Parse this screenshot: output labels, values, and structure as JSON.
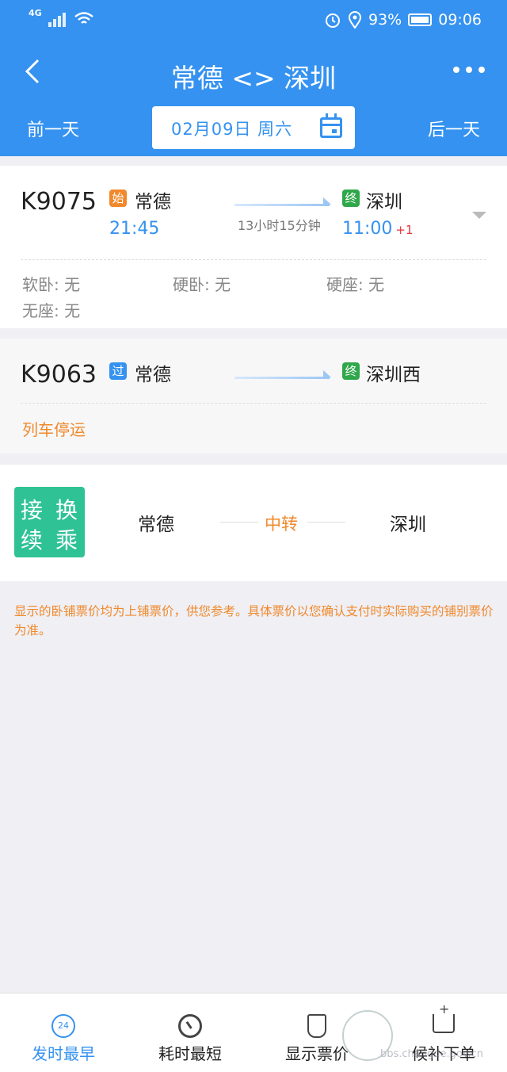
{
  "status": {
    "network": "4G",
    "battery": "93%",
    "time": "09:06"
  },
  "header": {
    "title": "常德 <> 深圳",
    "prev_day": "前一天",
    "next_day": "后一天",
    "date": "02月09日 周六"
  },
  "trains": [
    {
      "number": "K9075",
      "from_tag": "始",
      "from": "常德",
      "depart": "21:45",
      "duration": "13小时15分钟",
      "to_tag": "终",
      "to": "深圳",
      "arrive": "11:00",
      "day_offset": "+1",
      "seats": [
        "软卧: 无",
        "硬卧: 无",
        "硬座: 无",
        "无座: 无"
      ]
    },
    {
      "number": "K9063",
      "from_tag": "过",
      "from": "常德",
      "to_tag": "终",
      "to": "深圳西",
      "status": "列车停运"
    }
  ],
  "transfer": {
    "badge": [
      "接",
      "换",
      "续",
      "乘"
    ],
    "from": "常德",
    "via": "中转",
    "to": "深圳"
  },
  "notice": "显示的卧铺票价均为上铺票价，供您参考。具体票价以您确认支付时实际购买的铺别票价为准。",
  "bottom_tabs": [
    {
      "label": "发时最早",
      "icon": "clock-24-icon",
      "icon_text": "24",
      "color": "#3592f0"
    },
    {
      "label": "耗时最短",
      "icon": "timer-icon"
    },
    {
      "label": "显示票价",
      "icon": "price-tag-icon"
    },
    {
      "label": "候补下单",
      "icon": "cart-add-icon"
    }
  ],
  "watermark": {
    "url": "bbs.changde.gov.cn"
  },
  "colors": {
    "primary": "#3592f0",
    "orange": "#f0892b",
    "green": "#2fc295",
    "red": "#e0373c"
  }
}
